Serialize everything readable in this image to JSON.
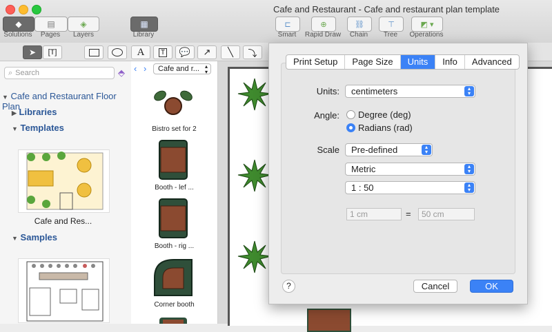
{
  "window": {
    "title": "Cafe and Restaurant - Cafe and restaurant plan template"
  },
  "toolbar": {
    "left_tabs": [
      {
        "label": "Solutions",
        "icon": "diamond-icon"
      },
      {
        "label": "Pages",
        "icon": "pages-icon"
      },
      {
        "label": "Layers",
        "icon": "layers-icon"
      }
    ],
    "library_label": "Library",
    "right_tools": [
      {
        "label": "Smart"
      },
      {
        "label": "Rapid Draw"
      },
      {
        "label": "Chain"
      },
      {
        "label": "Tree"
      },
      {
        "label": "Operations"
      }
    ]
  },
  "search": {
    "placeholder": "Search"
  },
  "tree": {
    "root": "Cafe and Restaurant Floor Plan",
    "libraries": "Libraries",
    "templates": "Templates",
    "template_item": "Cafe and Res...",
    "samples": "Samples"
  },
  "library": {
    "selector": "Cafe and r...",
    "items": [
      {
        "label": "Bistro set for 2"
      },
      {
        "label": "Booth - lef ..."
      },
      {
        "label": "Booth - rig ..."
      },
      {
        "label": "Corner booth"
      }
    ]
  },
  "dialog": {
    "tabs": [
      "Print Setup",
      "Page Size",
      "Units",
      "Info",
      "Advanced"
    ],
    "active_tab": "Units",
    "units_label": "Units:",
    "units_value": "centimeters",
    "angle_label": "Angle:",
    "angle_options": [
      "Degree (deg)",
      "Radians (rad)"
    ],
    "angle_selected": "Radians (rad)",
    "scale_label": "Scale",
    "scale_mode": "Pre-defined",
    "scale_system": "Metric",
    "scale_ratio": "1 : 50",
    "scale_left": "1 cm",
    "scale_equals": "=",
    "scale_right": "50 cm",
    "help": "?",
    "cancel": "Cancel",
    "ok": "OK"
  },
  "colors": {
    "accent": "#3b82f6",
    "title_blue": "#2b5797"
  }
}
